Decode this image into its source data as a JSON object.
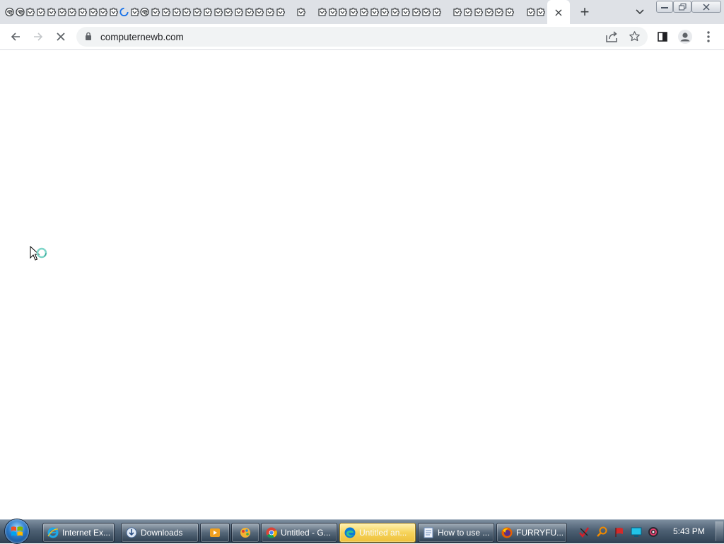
{
  "browser": {
    "pinned_tab_icons": [
      "edge-icon",
      "edge-icon",
      "puzzle-icon",
      "puzzle-icon",
      "puzzle-icon",
      "puzzle-icon",
      "puzzle-icon",
      "puzzle-icon",
      "puzzle-icon",
      "puzzle-icon",
      "puzzle-icon",
      "loading-spinner-icon",
      "puzzle-icon",
      "edge-icon",
      "puzzle-icon",
      "puzzle-icon",
      "puzzle-icon",
      "puzzle-icon",
      "puzzle-icon",
      "puzzle-icon",
      "puzzle-icon",
      "puzzle-icon",
      "puzzle-icon",
      "puzzle-icon",
      "puzzle-icon",
      "puzzle-icon",
      "puzzle-icon",
      "gap",
      "puzzle-icon",
      "gap",
      "puzzle-icon",
      "puzzle-icon",
      "puzzle-icon",
      "puzzle-icon",
      "puzzle-icon",
      "puzzle-icon",
      "puzzle-icon",
      "puzzle-icon",
      "puzzle-icon",
      "puzzle-icon",
      "puzzle-icon",
      "puzzle-icon",
      "gap",
      "puzzle-icon",
      "puzzle-icon",
      "puzzle-icon",
      "puzzle-icon",
      "puzzle-icon",
      "puzzle-icon",
      "gap",
      "puzzle-icon",
      "puzzle-icon"
    ],
    "active_tab_close": "×",
    "new_tab": "+",
    "url": "computernewb.com",
    "page_state": "loading"
  },
  "taskbar": {
    "buttons": [
      {
        "label": "Internet Ex...",
        "icon": "internet-explorer-icon"
      },
      {
        "label": "Downloads",
        "icon": "downloads-folder-icon"
      },
      {
        "label": "",
        "icon": "media-player-icon"
      },
      {
        "label": "",
        "icon": "paint-app-icon"
      },
      {
        "label": "Untitled - G...",
        "icon": "chrome-icon"
      },
      {
        "label": "Untitled an...",
        "icon": "edge-icon"
      },
      {
        "label": "How to use ...",
        "icon": "notepad-icon"
      },
      {
        "label": "FURRYFU...",
        "icon": "firefox-icon"
      }
    ],
    "tray_icons": [
      "antivirus-icon",
      "search-tool-icon",
      "flag-icon",
      "network-icon",
      "volume-icon"
    ],
    "clock": "5:43 PM"
  },
  "colors": {
    "tabstrip_bg": "#dee1e6",
    "omnibox_bg": "#f1f3f4",
    "highlight_taskbar_button": "#f6d35a"
  }
}
